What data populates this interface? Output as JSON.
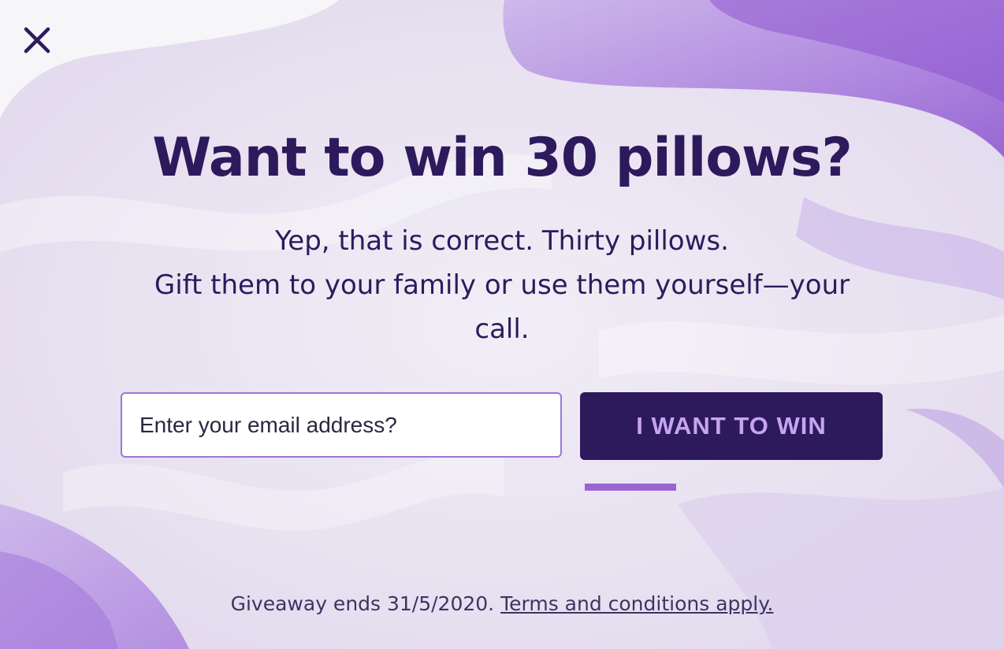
{
  "popup": {
    "close_icon": "close-icon",
    "headline": "Want to win 30 pillows?",
    "subtext_line1": "Yep, that is correct. Thirty pillows.",
    "subtext_line2": "Gift them to your family or use them yourself—your call.",
    "email_placeholder": "Enter your email address?",
    "email_value": "",
    "cta_label": "I WANT TO WIN",
    "footer_text": "Giveaway ends 31/5/2020.",
    "terms_link": "Terms and conditions apply."
  },
  "colors": {
    "primary_dark": "#2d1a5c",
    "accent_purple": "#9b63d4",
    "cta_text": "#c7a4ef",
    "background": "#ece8f3"
  }
}
